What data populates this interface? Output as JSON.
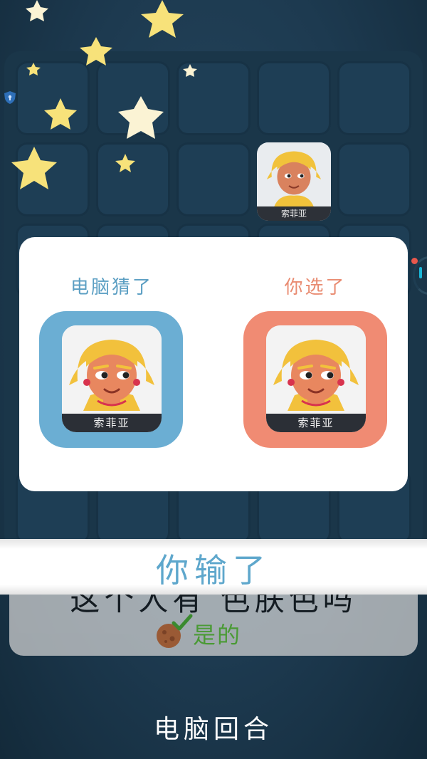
{
  "modal": {
    "computer_guess_label": "电脑猜了",
    "your_pick_label": "你选了",
    "computer_guess_name": "索菲亚",
    "your_pick_name": "索菲亚"
  },
  "board": {
    "revealed_character_name": "索菲亚"
  },
  "result": {
    "banner_text": "你输了"
  },
  "question": {
    "text": "这个人有 色肤色吗",
    "answer": "是的"
  },
  "turn": {
    "label": "电脑回合"
  },
  "colors": {
    "background": "#1d3a50",
    "computer_card": "#6baed3",
    "your_card": "#f08b73",
    "banner_text": "#5ea7cc",
    "answer_green": "#4a9a35",
    "star_yellow": "#f7e27a"
  }
}
